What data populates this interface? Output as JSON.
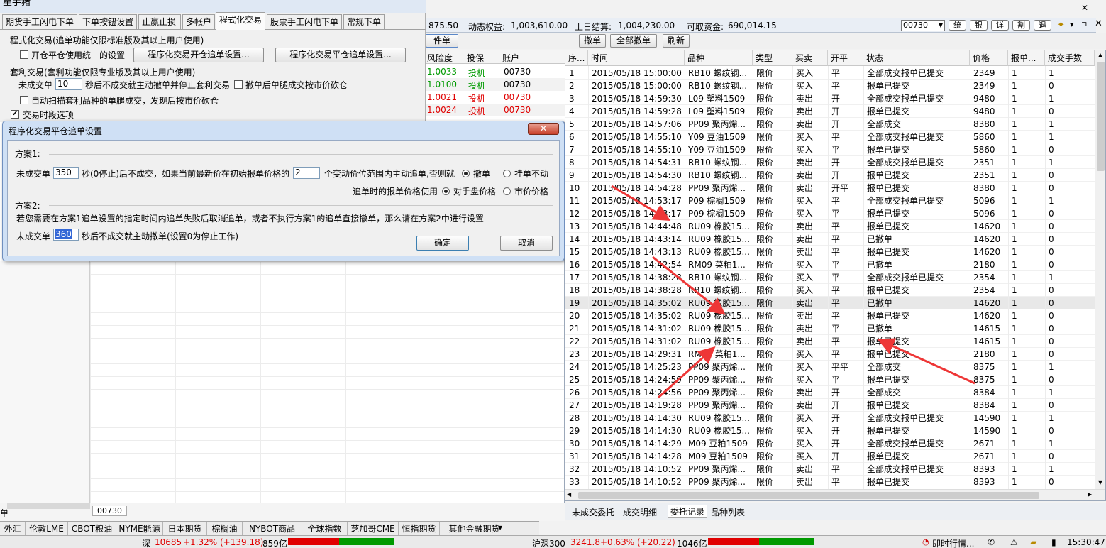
{
  "colors": {
    "red": "#e00000",
    "green": "#009a00",
    "arrow": "#ee3636"
  },
  "topbar": {
    "left_value": "875.50",
    "dyn_equity_label": "动态权益:",
    "dyn_equity": "1,003,610.00",
    "prev_settle_label": "上日结算:",
    "prev_settle": "1,004,230.00",
    "avail_label": "可取资金:",
    "avail": "690,014.15",
    "account_select": "00730",
    "quick_buttons": [
      "统",
      "银",
      "详",
      "割",
      "退"
    ]
  },
  "toolbar": {
    "left_btn": "件单",
    "cancel": "撤单",
    "cancel_all": "全部撤单",
    "refresh": "刷新"
  },
  "left_table": {
    "headers": [
      "风险度",
      "投保",
      "账户"
    ],
    "rows": [
      {
        "a": "1.0033",
        "b": "投机",
        "c": "00730",
        "red": false
      },
      {
        "a": "1.0100",
        "b": "投机",
        "c": "00730",
        "red": false
      },
      {
        "a": "1.0021",
        "b": "投机",
        "c": "00730",
        "red": true
      },
      {
        "a": "1.0024",
        "b": "投机",
        "c": "00730",
        "red": true
      }
    ]
  },
  "left_panel": {
    "title_fragment": "星手猪",
    "tabs": [
      "期货手工闪电下单",
      "下单按钮设置",
      "止赢止损",
      "多帐户",
      "程式化交易",
      "股票手工闪电下单",
      "常规下单"
    ],
    "section1": "程式化交易(追单功能仅限标准版及其以上用户使用)",
    "open_close_unified": "开仓平仓使用统一的设置",
    "open_chase_btn": "程序化交易开仓追单设置...",
    "close_chase_btn": "程序化交易平仓追单设置...",
    "section2": "套利交易(套利功能仅限专业版及其以上用户使用)",
    "untraded_label": "未成交单",
    "untraded_value": "10",
    "untraded_tail": "秒后不成交就主动撤单并停止套利交易",
    "cancel_leg_label": "撤单后单腿成交按市价砍仓",
    "auto_scan_label": "自动扫描套利品种的单腿成交，发现后按市价砍仓",
    "session_label": "交易时段选项"
  },
  "dialog": {
    "title": "程序化交易平仓追单设置",
    "close": "✕",
    "plan1": "方案1:",
    "p1_pre": "未成交单",
    "p1_sec": "350",
    "p1_mid": "秒(0停止)后不成交，如果当前最新价在初始报单价格的",
    "p1_ticks": "2",
    "p1_post": "个变动价位范围内主动追单,否则就",
    "opt_cancel": "撤单",
    "opt_hold": "挂单不动",
    "price_label": "追单时的报单价格使用",
    "opt_counter": "对手盘价格",
    "opt_market": "市价价格",
    "plan2": "方案2:",
    "plan2_desc": "若您需要在方案1追单设置的指定时间内追单失败后取消追单，或者不执行方案1的追单直接撤单，那么请在方案2中进行设置",
    "p2_pre": "未成交单",
    "p2_sec": "360",
    "p2_post": "秒后不成交就主动撤单(设置0为停止工作)",
    "ok": "确定",
    "cancel": "取消"
  },
  "grid": {
    "headers": [
      "序...",
      "时间",
      "品种",
      "类型",
      "买卖",
      "开平",
      "状态",
      "价格",
      "报单...",
      "成交手数"
    ],
    "rows": [
      [
        "1",
        "2015/05/18 15:00:00",
        "RB10 螺纹钢...",
        "限价",
        "买入",
        "平",
        "全部成交报单已提交",
        "2349",
        "1",
        "1"
      ],
      [
        "2",
        "2015/05/18 15:00:00",
        "RB10 螺纹钢...",
        "限价",
        "买入",
        "平",
        "报单已提交",
        "2349",
        "1",
        "0"
      ],
      [
        "3",
        "2015/05/18 14:59:30",
        "L09 塑料1509",
        "限价",
        "卖出",
        "开",
        "全部成交报单已提交",
        "9480",
        "1",
        "1"
      ],
      [
        "4",
        "2015/05/18 14:59:28",
        "L09 塑料1509",
        "限价",
        "卖出",
        "开",
        "报单已提交",
        "9480",
        "1",
        "0"
      ],
      [
        "5",
        "2015/05/18 14:57:06",
        "PP09 聚丙烯...",
        "限价",
        "卖出",
        "开",
        "全部成交",
        "8380",
        "1",
        "1"
      ],
      [
        "6",
        "2015/05/18 14:55:10",
        "Y09 豆油1509",
        "限价",
        "买入",
        "平",
        "全部成交报单已提交",
        "5860",
        "1",
        "1"
      ],
      [
        "7",
        "2015/05/18 14:55:10",
        "Y09 豆油1509",
        "限价",
        "买入",
        "平",
        "报单已提交",
        "5860",
        "1",
        "0"
      ],
      [
        "8",
        "2015/05/18 14:54:31",
        "RB10 螺纹钢...",
        "限价",
        "卖出",
        "开",
        "全部成交报单已提交",
        "2351",
        "1",
        "1"
      ],
      [
        "9",
        "2015/05/18 14:54:30",
        "RB10 螺纹钢...",
        "限价",
        "卖出",
        "开",
        "报单已提交",
        "2351",
        "1",
        "0"
      ],
      [
        "10",
        "2015/05/18 14:54:28",
        "PP09 聚丙烯...",
        "限价",
        "卖出",
        "开平",
        "报单已提交",
        "8380",
        "1",
        "0"
      ],
      [
        "11",
        "2015/05/18 14:53:17",
        "P09 棕榈1509",
        "限价",
        "买入",
        "平",
        "全部成交报单已提交",
        "5096",
        "1",
        "1"
      ],
      [
        "12",
        "2015/05/18 14:53:17",
        "P09 棕榈1509",
        "限价",
        "买入",
        "平",
        "报单已提交",
        "5096",
        "1",
        "0"
      ],
      [
        "13",
        "2015/05/18 14:44:48",
        "RU09 橡胶15...",
        "限价",
        "卖出",
        "平",
        "报单已提交",
        "14620",
        "1",
        "0"
      ],
      [
        "14",
        "2015/05/18 14:43:14",
        "RU09 橡胶15...",
        "限价",
        "卖出",
        "平",
        "已撤单",
        "14620",
        "1",
        "0"
      ],
      [
        "15",
        "2015/05/18 14:43:13",
        "RU09 橡胶15...",
        "限价",
        "卖出",
        "平",
        "报单已提交",
        "14620",
        "1",
        "0"
      ],
      [
        "16",
        "2015/05/18 14:42:54",
        "RM09 菜粕1...",
        "限价",
        "买入",
        "平",
        "已撤单",
        "2180",
        "1",
        "0"
      ],
      [
        "17",
        "2015/05/18 14:38:28",
        "RB10 螺纹钢...",
        "限价",
        "买入",
        "平",
        "全部成交报单已提交",
        "2354",
        "1",
        "1"
      ],
      [
        "18",
        "2015/05/18 14:38:28",
        "RB10 螺纹钢...",
        "限价",
        "买入",
        "平",
        "报单已提交",
        "2354",
        "1",
        "0"
      ],
      [
        "19",
        "2015/05/18 14:35:02",
        "RU09 橡胶15...",
        "限价",
        "卖出",
        "平",
        "已撤单",
        "14620",
        "1",
        "0"
      ],
      [
        "20",
        "2015/05/18 14:35:02",
        "RU09 橡胶15...",
        "限价",
        "卖出",
        "平",
        "报单已提交",
        "14620",
        "1",
        "0"
      ],
      [
        "21",
        "2015/05/18 14:31:02",
        "RU09 橡胶15...",
        "限价",
        "卖出",
        "平",
        "已撤单",
        "14615",
        "1",
        "0"
      ],
      [
        "22",
        "2015/05/18 14:31:02",
        "RU09 橡胶15...",
        "限价",
        "卖出",
        "平",
        "报单已提交",
        "14615",
        "1",
        "0"
      ],
      [
        "23",
        "2015/05/18 14:29:31",
        "RM09 菜粕1...",
        "限价",
        "买入",
        "平",
        "报单已提交",
        "2180",
        "1",
        "0"
      ],
      [
        "24",
        "2015/05/18 14:25:23",
        "PP09 聚丙烯...",
        "限价",
        "买入",
        "平平",
        "全部成交",
        "8375",
        "1",
        "1"
      ],
      [
        "25",
        "2015/05/18 14:24:59",
        "PP09 聚丙烯...",
        "限价",
        "买入",
        "平",
        "报单已提交",
        "8375",
        "1",
        "0"
      ],
      [
        "26",
        "2015/05/18 14:24:56",
        "PP09 聚丙烯...",
        "限价",
        "卖出",
        "开",
        "全部成交",
        "8384",
        "1",
        "1"
      ],
      [
        "27",
        "2015/05/18 14:19:28",
        "PP09 聚丙烯...",
        "限价",
        "卖出",
        "开",
        "报单已提交",
        "8384",
        "1",
        "0"
      ],
      [
        "28",
        "2015/05/18 14:14:30",
        "RU09 橡胶15...",
        "限价",
        "买入",
        "开",
        "全部成交报单已提交",
        "14590",
        "1",
        "1"
      ],
      [
        "29",
        "2015/05/18 14:14:30",
        "RU09 橡胶15...",
        "限价",
        "买入",
        "开",
        "报单已提交",
        "14590",
        "1",
        "0"
      ],
      [
        "30",
        "2015/05/18 14:14:29",
        "M09 豆粕1509",
        "限价",
        "买入",
        "开",
        "全部成交报单已提交",
        "2671",
        "1",
        "1"
      ],
      [
        "31",
        "2015/05/18 14:14:28",
        "M09 豆粕1509",
        "限价",
        "买入",
        "开",
        "报单已提交",
        "2671",
        "1",
        "0"
      ],
      [
        "32",
        "2015/05/18 14:10:52",
        "PP09 聚丙烯...",
        "限价",
        "卖出",
        "平",
        "全部成交报单已提交",
        "8393",
        "1",
        "1"
      ],
      [
        "33",
        "2015/05/18 14:10:52",
        "PP09 聚丙烯...",
        "限价",
        "卖出",
        "平",
        "报单已提交",
        "8393",
        "1",
        "0"
      ]
    ]
  },
  "right_tabs": [
    "未成交委托",
    "成交明细",
    "委托记录",
    "品种列表"
  ],
  "mid_tab": "00730",
  "left_tab_fragment": "单",
  "bottom_tabs": [
    "外汇",
    "伦敦LME",
    "CBOT粮油",
    "NYME能源",
    "日本期货",
    "棕榈油",
    "NYBOT商品",
    "全球指数",
    "芝加哥CME",
    "恒指期货",
    "其他金融期货"
  ],
  "status": {
    "sz_label": "深",
    "sz_value": "10685",
    "sz_change": "+1.32% (+139.18)",
    "sz_volume": "859亿",
    "hs_label": "沪深300",
    "hs_value": "3241.8",
    "hs_change": "+0.63% (+20.22)",
    "hs_volume": "1046亿",
    "news": "即时行情...",
    "clock": "15:30:47"
  }
}
